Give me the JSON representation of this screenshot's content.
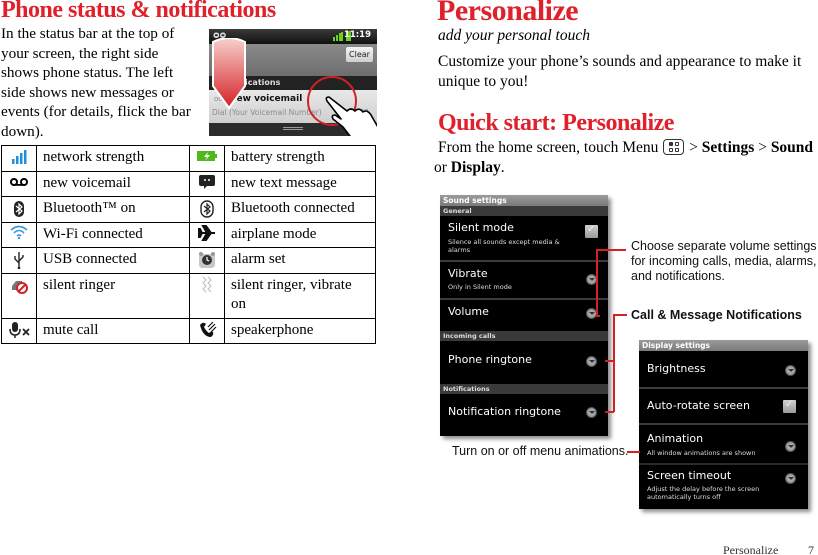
{
  "left_page": {
    "title": "Phone status & notifications",
    "intro": "In the status bar at the top of your screen, the right side shows phone status. The left side shows new messages or events (for details, flick the bar down).",
    "phone_screenshot": {
      "status_left_icon": "voicemail-icon",
      "time": "11:19",
      "clear_button": "Clear",
      "notifications_header": "Notifications",
      "notification_title": "New voicemail",
      "notification_subtitle": "Dial (Your Voicemail Number)",
      "notification_time_partial": "32"
    },
    "icon_table": [
      [
        {
          "icon": "network-strength-icon",
          "label": "network strength"
        },
        {
          "icon": "battery-strength-icon",
          "label": "battery strength"
        }
      ],
      [
        {
          "icon": "voicemail-icon",
          "label": "new voicemail"
        },
        {
          "icon": "text-message-icon",
          "label": "new text message"
        }
      ],
      [
        {
          "icon": "bluetooth-on-icon",
          "label": "Bluetooth™ on"
        },
        {
          "icon": "bluetooth-connected-icon",
          "label": "Bluetooth connected"
        }
      ],
      [
        {
          "icon": "wifi-icon",
          "label": "Wi-Fi connected"
        },
        {
          "icon": "airplane-icon",
          "label": "airplane mode"
        }
      ],
      [
        {
          "icon": "usb-icon",
          "label": "USB connected"
        },
        {
          "icon": "alarm-icon",
          "label": "alarm set"
        }
      ],
      [
        {
          "icon": "silent-ringer-icon",
          "label": "silent ringer"
        },
        {
          "icon": "vibrate-icon",
          "label": "silent ringer, vibrate on"
        }
      ],
      [
        {
          "icon": "mute-call-icon",
          "label": "mute call"
        },
        {
          "icon": "speakerphone-icon",
          "label": "speakerphone"
        }
      ]
    ]
  },
  "right_page": {
    "title": "Personalize",
    "subtitle": "add your personal touch",
    "intro": "Customize your phone’s sounds and appearance to make it unique to you!",
    "quick_start_title": "Quick start: Personalize",
    "quick_start": {
      "text_before": "From the home screen, touch Menu",
      "sep1": " > ",
      "settings": "Settings",
      "sep2": " > ",
      "sound": "Sound",
      "or": " or ",
      "display": "Display",
      "end": "."
    },
    "sound_settings": {
      "title": "Sound settings",
      "general_header": "General",
      "silent_mode": {
        "title": "Silent mode",
        "subtitle": "Silence all sounds except media & alarms",
        "checked": true
      },
      "vibrate": {
        "title": "Vibrate",
        "subtitle": "Only in Silent mode"
      },
      "volume": {
        "title": "Volume"
      },
      "incoming_calls_header": "Incoming calls",
      "phone_ringtone": {
        "title": "Phone ringtone"
      },
      "notifications_header": "Notifications",
      "notification_ringtone": {
        "title": "Notification ringtone"
      }
    },
    "display_settings": {
      "title": "Display settings",
      "brightness": {
        "title": "Brightness"
      },
      "auto_rotate": {
        "title": "Auto-rotate screen",
        "checked": true
      },
      "animation": {
        "title": "Animation",
        "subtitle": "All window animations are shown"
      },
      "screen_timeout": {
        "title": "Screen timeout",
        "subtitle": "Adjust the delay before the screen automatically turns off"
      }
    },
    "callouts": {
      "volume": "Choose separate volume settings for incoming calls, media, alarms, and notifications.",
      "notifications": "Call & Message Notifications",
      "animation": "Turn on or off menu animations."
    },
    "accent_color": "#e0202a"
  },
  "footer": {
    "section": "Personalize",
    "page_number": "7"
  }
}
